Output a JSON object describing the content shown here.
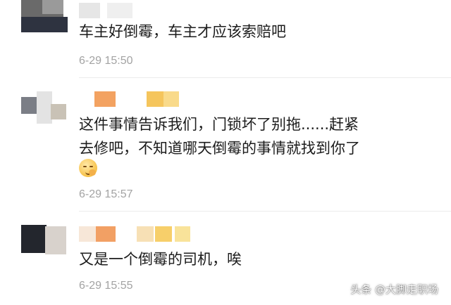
{
  "comments": [
    {
      "text_lines": [
        "车主好倒霉，车主才应该索赔吧"
      ],
      "time": "6-29 15:50",
      "emoji": "shush-face-icon"
    },
    {
      "text_lines": [
        "这件事情告诉我们，门锁坏了别拖......赶紧",
        "去修吧，不知道哪天倒霉的事情就找到你了"
      ],
      "time": "6-29 15:57",
      "emoji": "shush-face-icon"
    },
    {
      "text_lines": [
        "又是一个倒霉的司机，唉"
      ],
      "time": "6-29 15:55"
    }
  ],
  "watermark": "头条 @大脚走职场",
  "colors": {
    "text": "#1c1c1c",
    "time": "#a3a3a3",
    "name_orange": "#f39a57",
    "name_yellow": "#f7c95a"
  }
}
